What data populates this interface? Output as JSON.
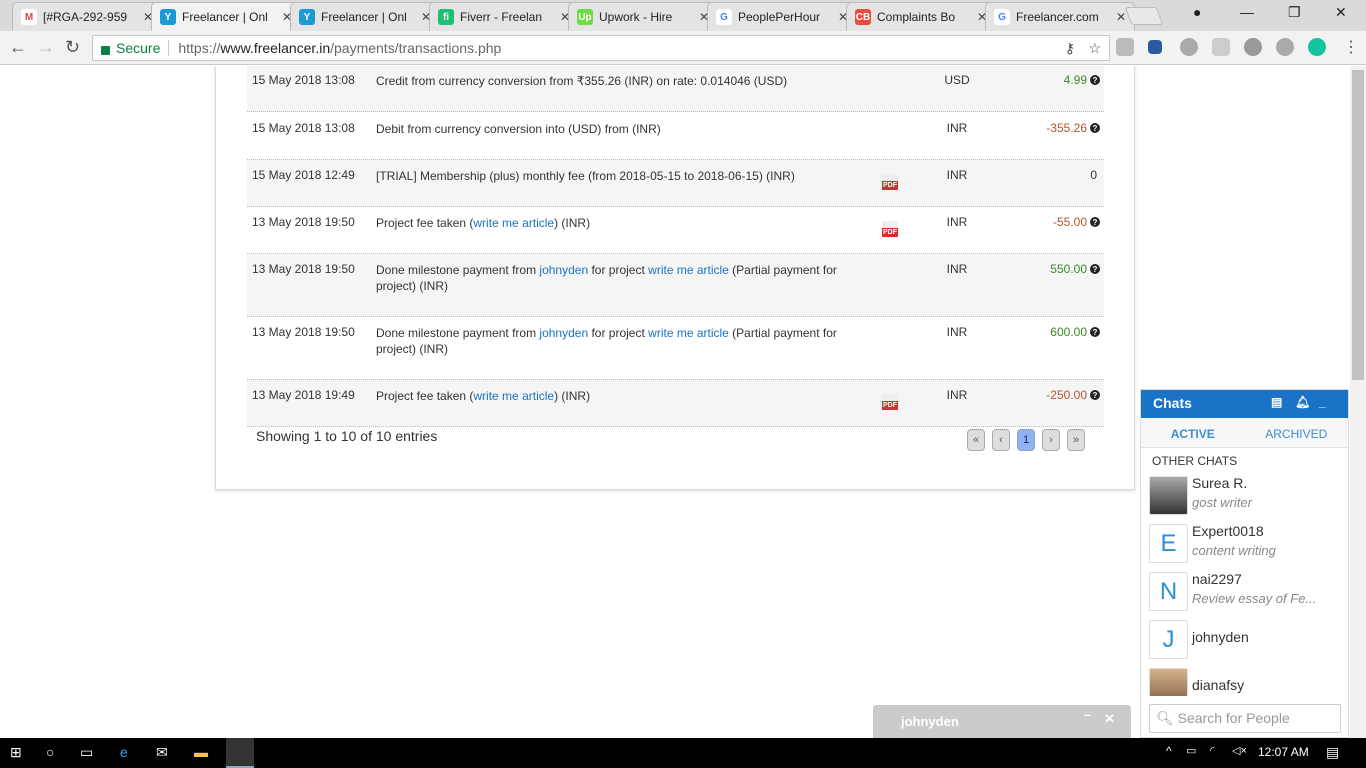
{
  "browser": {
    "tabs": [
      {
        "title": "[#RGA-292-959",
        "icon": "M",
        "color": "#ffffff",
        "fg": "#d44"
      },
      {
        "title": "Freelancer | Onl",
        "icon": "Y",
        "color": "#1b9ad6",
        "fg": "#fff",
        "active": true
      },
      {
        "title": "Freelancer | Onl",
        "icon": "Y",
        "color": "#1b9ad6",
        "fg": "#fff"
      },
      {
        "title": "Fiverr - Freelan",
        "icon": "fi",
        "color": "#1dbf73",
        "fg": "#fff"
      },
      {
        "title": "Upwork - Hire",
        "icon": "Up",
        "color": "#6fda44",
        "fg": "#fff"
      },
      {
        "title": "PeoplePerHour",
        "icon": "G",
        "color": "#ffffff",
        "fg": "#4285f4"
      },
      {
        "title": "Complaints Bo",
        "icon": "CB",
        "color": "#e74c3c",
        "fg": "#fff"
      },
      {
        "title": "Freelancer.com",
        "icon": "G",
        "color": "#ffffff",
        "fg": "#4285f4"
      }
    ],
    "secure_label": "Secure",
    "url_prefix": "https://",
    "url_host": "www.freelancer.in",
    "url_path": "/payments/transactions.php"
  },
  "transactions": [
    {
      "date": "15 May 2018 13:08",
      "desc": [
        {
          "t": "Credit from currency conversion from ₹355.26 (INR) on rate: 0.014046 (USD)"
        }
      ],
      "pdf": false,
      "currency": "USD",
      "amount": "4.99",
      "type": "pos",
      "help": true
    },
    {
      "date": "15 May 2018 13:08",
      "desc": [
        {
          "t": "Debit from currency conversion into (USD) from (INR)"
        }
      ],
      "pdf": false,
      "currency": "INR",
      "amount": "-355.26",
      "type": "neg",
      "help": true
    },
    {
      "date": "15 May 2018 12:49",
      "desc": [
        {
          "t": "[TRIAL] Membership (plus) monthly fee (from 2018-05-15 to 2018-06-15) (INR)"
        }
      ],
      "pdf": true,
      "currency": "INR",
      "amount": "0",
      "type": "zero",
      "help": false
    },
    {
      "date": "13 May 2018 19:50",
      "desc": [
        {
          "t": "Project fee taken ("
        },
        {
          "t": "write me article",
          "link": true
        },
        {
          "t": ") (INR)"
        }
      ],
      "pdf": true,
      "currency": "INR",
      "amount": "-55.00",
      "type": "neg",
      "help": true
    },
    {
      "date": "13 May 2018 19:50",
      "desc": [
        {
          "t": "Done milestone payment from "
        },
        {
          "t": "johnyden",
          "link": true
        },
        {
          "t": " for project "
        },
        {
          "t": "write me article",
          "link": true
        },
        {
          "t": " (Partial payment for project) (INR)"
        }
      ],
      "pdf": false,
      "currency": "INR",
      "amount": "550.00",
      "type": "pos",
      "help": true
    },
    {
      "date": "13 May 2018 19:50",
      "desc": [
        {
          "t": "Done milestone payment from "
        },
        {
          "t": "johnyden",
          "link": true
        },
        {
          "t": " for project "
        },
        {
          "t": "write me article",
          "link": true
        },
        {
          "t": " (Partial payment for project) (INR)"
        }
      ],
      "pdf": false,
      "currency": "INR",
      "amount": "600.00",
      "type": "pos",
      "help": true
    },
    {
      "date": "13 May 2018 19:49",
      "desc": [
        {
          "t": "Project fee taken ("
        },
        {
          "t": "write me article",
          "link": true
        },
        {
          "t": ") (INR)"
        }
      ],
      "pdf": true,
      "currency": "INR",
      "amount": "-250.00",
      "type": "neg",
      "help": true
    }
  ],
  "pdf_label": "PDF",
  "showing": "Showing 1 to 10 of 10 entries",
  "pager": {
    "first": "«",
    "prev": "‹",
    "current": "1",
    "next": "›",
    "last": "»"
  },
  "chat": {
    "title": "Chats",
    "tab_active": "ACTIVE",
    "tab_archived": "ARCHIVED",
    "section": "OTHER CHATS",
    "items": [
      {
        "name": "Surea R.",
        "sub": "gost writer",
        "avatar": "img"
      },
      {
        "name": "Expert0018",
        "sub": "content writing",
        "avatar": "E"
      },
      {
        "name": "nai2297",
        "sub": "Review essay of Fe...",
        "avatar": "N"
      },
      {
        "name": "johnyden",
        "sub": "",
        "avatar": "J"
      },
      {
        "name": "dianafsy",
        "sub": "",
        "avatar": "img2"
      }
    ],
    "search_placeholder": "Search for People",
    "popup_name": "johnyden"
  },
  "taskbar": {
    "time": "12:07 AM"
  }
}
